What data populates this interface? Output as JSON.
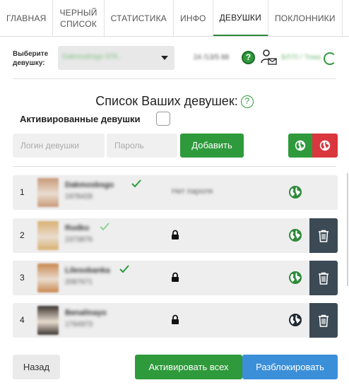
{
  "tabs": [
    {
      "label": "ГЛАВНАЯ",
      "active": false
    },
    {
      "label": "ЧЕРНЫЙ\nСПИСОК",
      "active": false
    },
    {
      "label": "СТАТИСТИКА",
      "active": false
    },
    {
      "label": "ИНФО",
      "active": false
    },
    {
      "label": "ДЕВУШКИ",
      "active": true
    },
    {
      "label": "ПОКЛОННИКИ",
      "active": false
    }
  ],
  "selector": {
    "label": "Выберите\nдевушку:",
    "value": "Dakmosbsgo 978..",
    "info": "24 /13/5 88",
    "info2": "ВЛ70 / Тема"
  },
  "list": {
    "title": "Список Ваших девушек:",
    "activated_label": "Активированные девушки"
  },
  "form": {
    "login_placeholder": "Логин девушки",
    "password_placeholder": "Пароль",
    "add_label": "Добавить"
  },
  "rows": [
    {
      "num": "1",
      "login": "Dakmosbsgo",
      "uid": "1978428",
      "verified": true,
      "password_hidden": false,
      "password_text": "Нет пароля",
      "globe_color": "#2e8b3a",
      "has_delete": false,
      "avatar": "#c99a7a"
    },
    {
      "num": "2",
      "login": "Rodko",
      "uid": "2373876",
      "verified": true,
      "password_hidden": true,
      "password_text": "",
      "globe_color": "#2e8b3a",
      "has_delete": true,
      "avatar": "#d8b070"
    },
    {
      "num": "3",
      "login": "Lilesobanka",
      "uid": "2087671",
      "verified": true,
      "password_hidden": true,
      "password_text": "",
      "globe_color": "#2e8b3a",
      "has_delete": true,
      "avatar": "#c8874e"
    },
    {
      "num": "4",
      "login": "Benalinayo",
      "uid": "1794973",
      "verified": false,
      "password_hidden": true,
      "password_text": "",
      "globe_color": "#1f2a33",
      "has_delete": true,
      "avatar": "#3c3530"
    }
  ],
  "footer": {
    "back_label": "Назад",
    "activate_all_label": "Активировать всех",
    "unblock_label": "Разблокировать"
  },
  "colors": {
    "green": "#2e9a3b",
    "red": "#d9363e",
    "blue": "#3b8fd8",
    "dark": "#3b4a55"
  }
}
